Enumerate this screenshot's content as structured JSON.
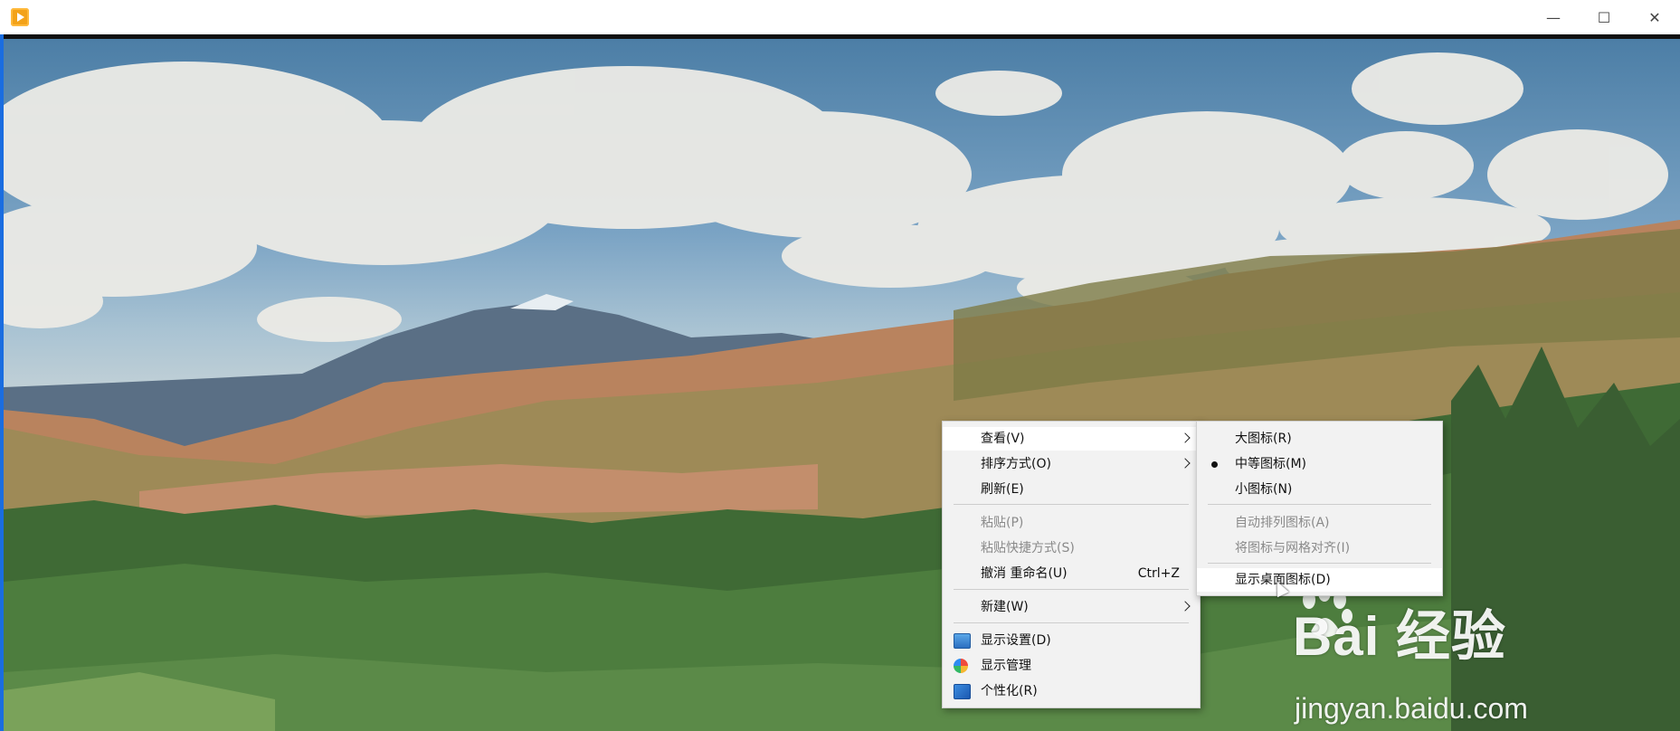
{
  "window": {
    "controls": {
      "minimize": "—",
      "maximize": "☐",
      "close": "✕"
    }
  },
  "context_menu": {
    "items": [
      {
        "label": "查看(V)",
        "has_submenu": true,
        "state": "highlighted"
      },
      {
        "label": "排序方式(O)",
        "has_submenu": true
      },
      {
        "label": "刷新(E)"
      },
      {
        "label": "粘贴(P)",
        "state": "disabled"
      },
      {
        "label": "粘贴快捷方式(S)",
        "state": "disabled"
      },
      {
        "label": "撤消 重命名(U)",
        "shortcut": "Ctrl+Z"
      },
      {
        "label": "新建(W)",
        "has_submenu": true
      },
      {
        "label": "显示设置(D)",
        "icon": "display-settings-icon"
      },
      {
        "label": "显示管理",
        "icon": "display-manager-icon"
      },
      {
        "label": "个性化(R)",
        "icon": "personalize-icon"
      }
    ]
  },
  "view_submenu": {
    "items": [
      {
        "label": "大图标(R)"
      },
      {
        "label": "中等图标(M)",
        "selected": true
      },
      {
        "label": "小图标(N)"
      },
      {
        "label": "自动排列图标(A)",
        "state": "disabled"
      },
      {
        "label": "将图标与网格对齐(I)",
        "state": "disabled"
      },
      {
        "label": "显示桌面图标(D)",
        "state": "highlighted"
      }
    ]
  },
  "watermark": {
    "brand": "Bai  经验",
    "url": "jingyan.baidu.com"
  },
  "colors": {
    "titlebar": "#ffffff",
    "menu_bg": "#f2f2f2",
    "menu_hover": "#ffffff",
    "disabled_text": "#8a8a8a",
    "accent": "#1a6de0"
  }
}
